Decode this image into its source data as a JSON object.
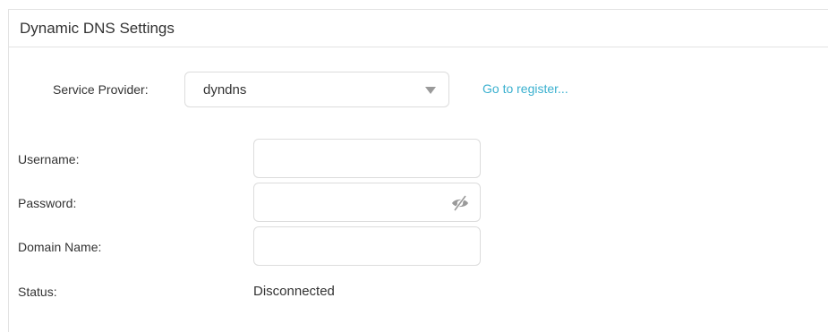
{
  "section": {
    "title": "Dynamic DNS Settings"
  },
  "service_provider": {
    "label": "Service Provider:",
    "selected": "dyndns",
    "register_link": "Go to register..."
  },
  "form": {
    "username_label": "Username:",
    "username_value": "",
    "password_label": "Password:",
    "password_value": "",
    "domain_label": "Domain Name:",
    "domain_value": "",
    "status_label": "Status:",
    "status_value": "Disconnected"
  },
  "icons": {
    "dropdown": "chevron-down-icon",
    "password_toggle": "eye-slash-icon"
  },
  "colors": {
    "link": "#3ab0cf",
    "border": "#dcdcdc",
    "text": "#333333",
    "icon": "#9a9a9a"
  }
}
